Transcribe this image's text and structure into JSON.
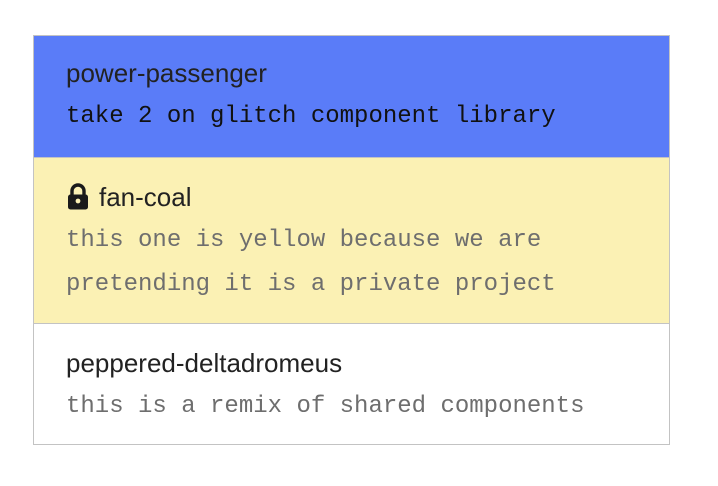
{
  "projects": [
    {
      "name": "power-passenger",
      "description": "take 2 on glitch component library",
      "color": "#5a7cf8",
      "private": false
    },
    {
      "name": "fan-coal",
      "description": "this one is yellow because we are pretending it is a private project",
      "color": "#fbf1b4",
      "private": true,
      "icon": "lock-icon"
    },
    {
      "name": "peppered-deltadromeus",
      "description": "this is a remix of shared components",
      "color": "#ffffff",
      "private": false
    }
  ]
}
